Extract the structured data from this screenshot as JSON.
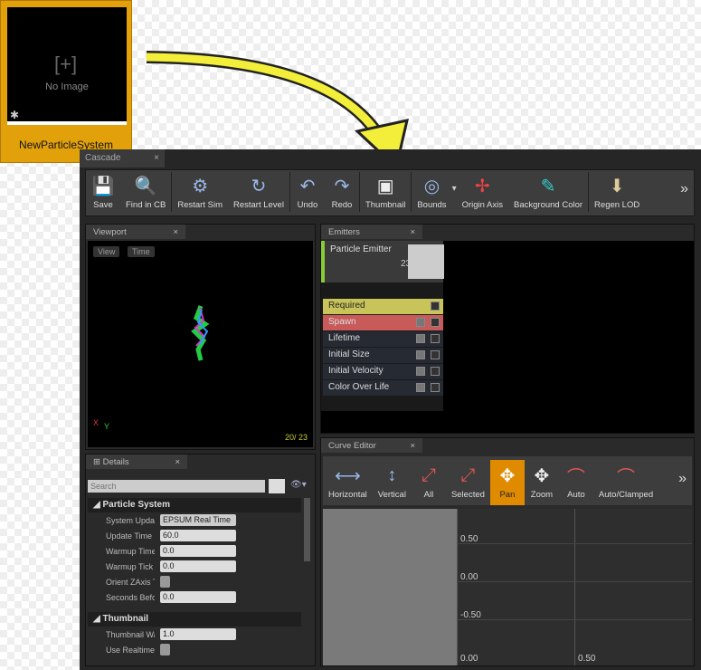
{
  "asset": {
    "no_image": "No Image",
    "plus": "[+]",
    "name": "NewParticleSystem"
  },
  "window": {
    "tab": "Cascade"
  },
  "toolbar": {
    "items": [
      {
        "label": "Save",
        "icon": "save-icon"
      },
      {
        "label": "Find in CB",
        "icon": "search-icon"
      },
      {
        "label": "Restart Sim",
        "icon": "gear-icon"
      },
      {
        "label": "Restart Level",
        "icon": "restart-icon"
      },
      {
        "label": "Undo",
        "icon": "undo-icon"
      },
      {
        "label": "Redo",
        "icon": "redo-icon"
      },
      {
        "label": "Thumbnail",
        "icon": "thumbnail-icon"
      },
      {
        "label": "Bounds",
        "icon": "bounds-icon"
      },
      {
        "label": "Origin Axis",
        "icon": "axis-icon"
      },
      {
        "label": "Background Color",
        "icon": "color-icon"
      },
      {
        "label": "Regen LOD",
        "icon": "lod-icon"
      }
    ],
    "more": "»"
  },
  "viewport": {
    "tab": "Viewport",
    "view": "View",
    "time": "Time",
    "counter": "20/ 23",
    "axis_x": "X",
    "axis_y": "Y"
  },
  "emitters": {
    "tab": "Emitters",
    "emitter_name": "Particle Emitter",
    "count": "23",
    "modules": [
      "Required",
      "Spawn",
      "Lifetime",
      "Initial Size",
      "Initial Velocity",
      "Color Over Life"
    ]
  },
  "details": {
    "tab": "Details",
    "search_placeholder": "Search",
    "sections": [
      {
        "title": "Particle System",
        "rows": [
          {
            "label": "System Update M",
            "value": "EPSUM Real Time ▾"
          },
          {
            "label": "Update Time FPS",
            "value": "60.0"
          },
          {
            "label": "Warmup Time",
            "value": "0.0"
          },
          {
            "label": "Warmup Tick Rate",
            "value": "0.0"
          },
          {
            "label": "Orient ZAxis Toward",
            "value": ""
          },
          {
            "label": "Seconds Before",
            "value": "0.0"
          }
        ]
      },
      {
        "title": "Thumbnail",
        "rows": [
          {
            "label": "Thumbnail Warmup",
            "value": "1.0"
          },
          {
            "label": "Use Realtime Thumbnail",
            "value": ""
          }
        ]
      }
    ]
  },
  "curve": {
    "tab": "Curve Editor",
    "tools": [
      "Horizontal",
      "Vertical",
      "All",
      "Selected",
      "Pan",
      "Zoom",
      "Auto",
      "Auto/Clamped"
    ],
    "active": "Pan",
    "y_labels": [
      "0.50",
      "0.00",
      "-0.50"
    ],
    "x_labels": [
      "0.00",
      "0.50"
    ]
  },
  "colors": {
    "accent": "#e2a10b",
    "required": "#c8c45a",
    "spawn": "#c85a5a",
    "pan_active": "#e08a00"
  }
}
